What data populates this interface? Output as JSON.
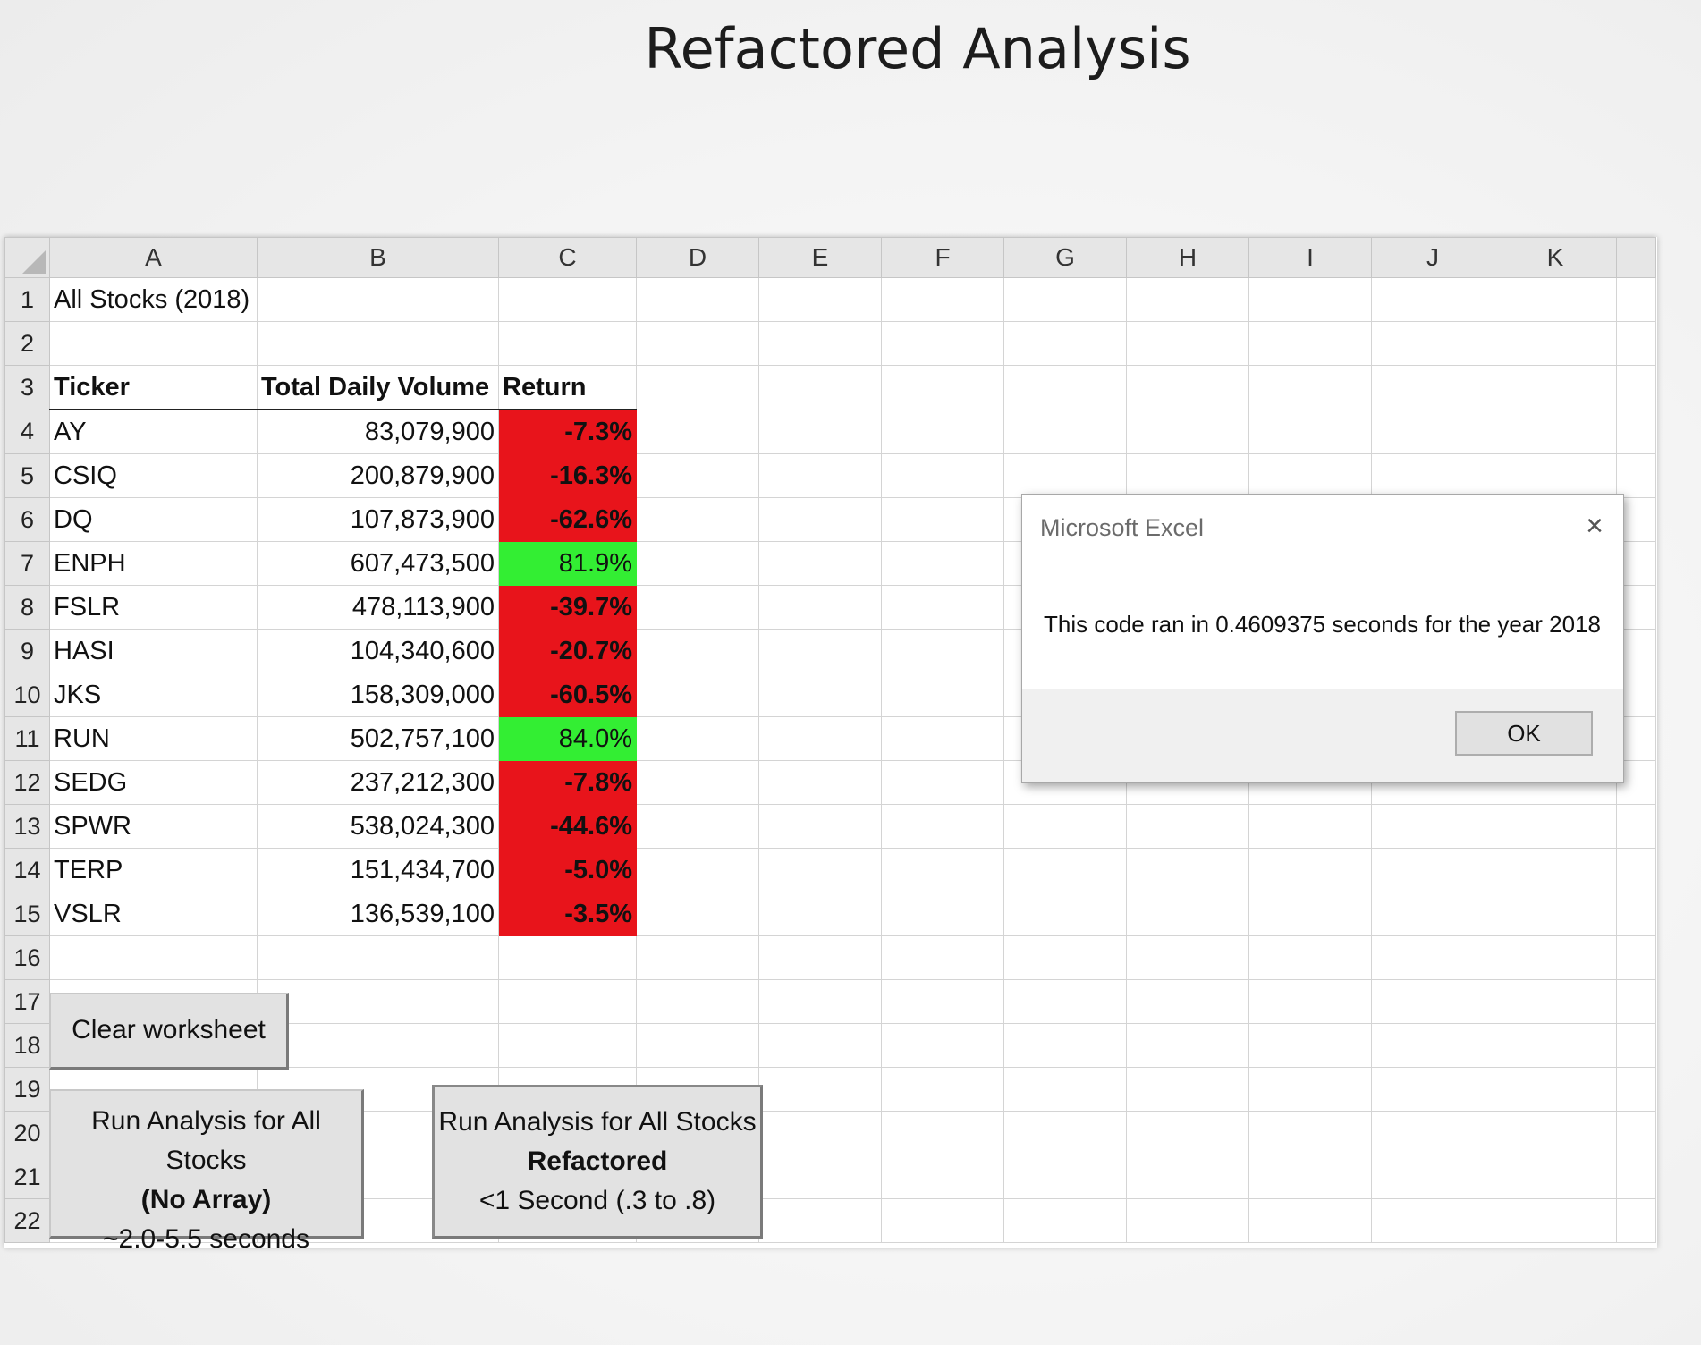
{
  "slide": {
    "title": "Refactored Analysis"
  },
  "columns": [
    "A",
    "B",
    "C",
    "D",
    "E",
    "F",
    "G",
    "H",
    "I",
    "J",
    "K"
  ],
  "row_numbers": [
    "1",
    "2",
    "3",
    "4",
    "5",
    "6",
    "7",
    "8",
    "9",
    "10",
    "11",
    "12",
    "13",
    "14",
    "15",
    "16",
    "17",
    "18",
    "19",
    "20",
    "21",
    "22"
  ],
  "sheet": {
    "title": "All Stocks (2018)",
    "headers": {
      "ticker": "Ticker",
      "volume": "Total Daily Volume",
      "return": "Return"
    },
    "rows": [
      {
        "ticker": "AY",
        "volume": "83,079,900",
        "return": "-7.3%"
      },
      {
        "ticker": "CSIQ",
        "volume": "200,879,900",
        "return": "-16.3%"
      },
      {
        "ticker": "DQ",
        "volume": "107,873,900",
        "return": "-62.6%"
      },
      {
        "ticker": "ENPH",
        "volume": "607,473,500",
        "return": "81.9%"
      },
      {
        "ticker": "FSLR",
        "volume": "478,113,900",
        "return": "-39.7%"
      },
      {
        "ticker": "HASI",
        "volume": "104,340,600",
        "return": "-20.7%"
      },
      {
        "ticker": "JKS",
        "volume": "158,309,000",
        "return": "-60.5%"
      },
      {
        "ticker": "RUN",
        "volume": "502,757,100",
        "return": "84.0%"
      },
      {
        "ticker": "SEDG",
        "volume": "237,212,300",
        "return": "-7.8%"
      },
      {
        "ticker": "SPWR",
        "volume": "538,024,300",
        "return": "-44.6%"
      },
      {
        "ticker": "TERP",
        "volume": "151,434,700",
        "return": "-5.0%"
      },
      {
        "ticker": "VSLR",
        "volume": "136,539,100",
        "return": "-3.5%"
      }
    ]
  },
  "colors": {
    "negative": "#e8141b",
    "positive": "#33ee33"
  },
  "buttons": {
    "clear": "Clear worksheet",
    "run_no_array": {
      "line1": "Run Analysis for All Stocks",
      "line2": "(No Array)",
      "line3": "~2.0-5.5 seconds"
    },
    "run_refactored": {
      "line1": "Run Analysis for All Stocks",
      "line2": "Refactored",
      "line3": "<1 Second (.3 to .8)"
    }
  },
  "dialog": {
    "title": "Microsoft Excel",
    "close_icon": "×",
    "message": "This code ran in 0.4609375 seconds for the year 2018",
    "ok_label": "OK"
  }
}
